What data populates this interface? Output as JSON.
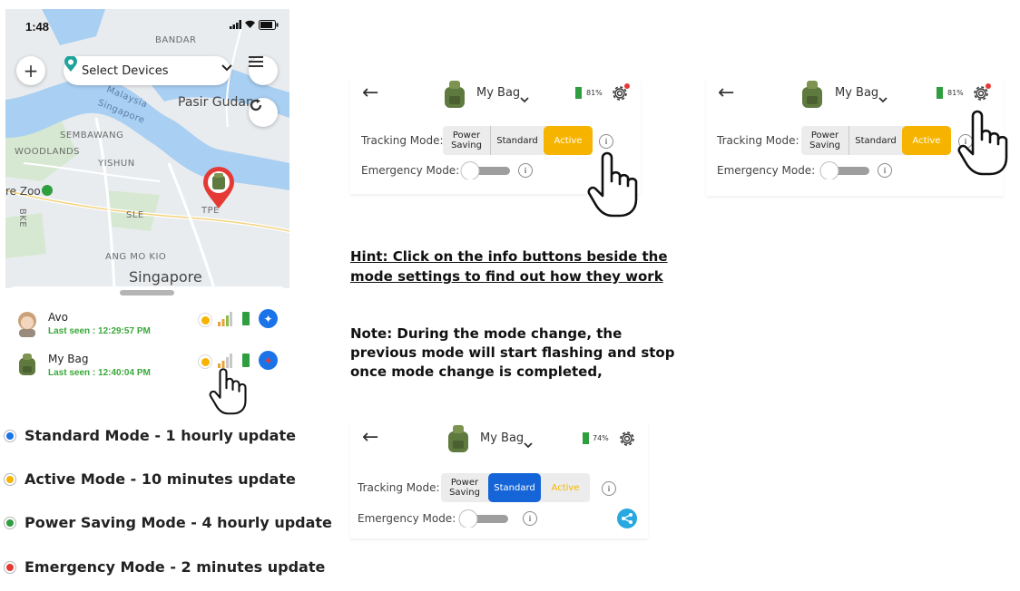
{
  "phone": {
    "status_bar": {
      "time": "1:48"
    },
    "select_devices_label": "Select Devices",
    "map_labels": {
      "bandar": "BANDAR",
      "pasir_gudang": "Pasir Gudan",
      "malaysia": "Malaysia",
      "singapore_small": "Singapore",
      "sembawang": "SEMBAWANG",
      "woodlands": "WOODLANDS",
      "yishun": "YISHUN",
      "zoo": "re Zoo",
      "bke": "BKE",
      "sle": "SLE",
      "tpe": "TPE",
      "ang_mo_kio": "ANG MO KIO",
      "singapore_big": "Singapore"
    },
    "devices": [
      {
        "name": "Avo",
        "last_seen": "Last seen : 12:29:57 PM"
      },
      {
        "name": "My Bag",
        "last_seen": "Last seen : 12:40:04 PM"
      }
    ]
  },
  "legend": [
    {
      "label": "Standard Mode - 1 hourly update",
      "color": "#1a73e8"
    },
    {
      "label": "Active Mode - 10 minutes update",
      "color": "#f6b400"
    },
    {
      "label": "Power Saving Mode - 4 hourly update",
      "color": "#2e9e3e"
    },
    {
      "label": "Emergency Mode - 2 minutes update",
      "color": "#e53935"
    }
  ],
  "panels": [
    {
      "device": "My Bag",
      "battery": "81%",
      "tracking_label": "Tracking Mode:",
      "emergency_label": "Emergency Mode:",
      "modes": {
        "power_saving": "Power Saving",
        "standard": "Standard",
        "active": "Active"
      },
      "selected": "active"
    },
    {
      "device": "My Bag",
      "battery": "81%",
      "tracking_label": "Tracking Mode:",
      "emergency_label": "Emergency Mode:",
      "modes": {
        "power_saving": "Power Saving",
        "standard": "Standard",
        "active": "Active"
      },
      "selected": "active"
    },
    {
      "device": "My Bag",
      "battery": "74%",
      "tracking_label": "Tracking Mode:",
      "emergency_label": "Emergency Mode:",
      "modes": {
        "power_saving": "Power Saving",
        "standard": "Standard",
        "active": "Active"
      },
      "selected": "standard"
    }
  ],
  "hint": "Hint: Click on the info buttons beside the mode settings to find out how they work",
  "note": "Note: During the mode change, the previous mode will start flashing and stop once mode change is completed,",
  "colors": {
    "active": "#f6b400",
    "standard": "#1565d8",
    "battery": "#2e9e3e",
    "pin": "#e53935"
  }
}
